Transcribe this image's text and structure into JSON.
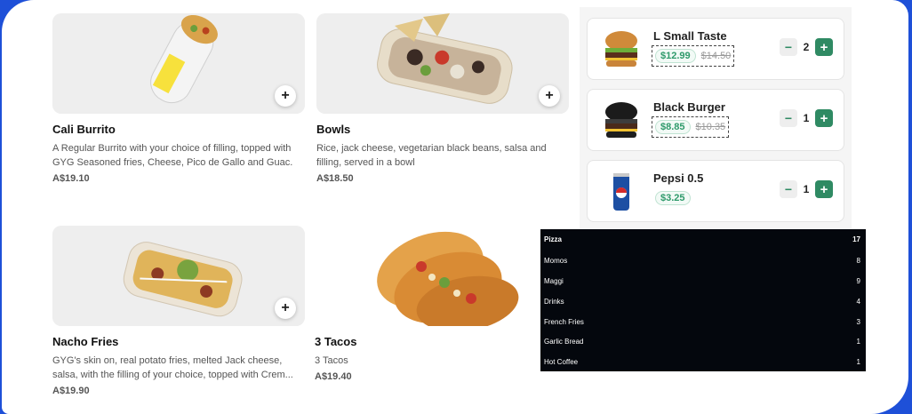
{
  "menu": {
    "items": [
      {
        "name": "Cali Burrito",
        "description": "A Regular Burrito with your choice of filling, topped with GYG Seasoned fries, Cheese, Pico de Gallo and Guac.",
        "price": "A$19.10",
        "add": "+"
      },
      {
        "name": "Bowls",
        "description": "Rice, jack cheese, vegetarian black beans, salsa and filling, served in a bowl",
        "price": "A$18.50",
        "add": "+"
      },
      {
        "name": "Nacho Fries",
        "description": "GYG's skin on, real potato fries, melted Jack cheese, salsa, with the filling of your choice, topped with Crem...",
        "price": "A$19.90",
        "add": "+"
      },
      {
        "name": "3 Tacos",
        "description": "3 Tacos",
        "price": "A$19.40"
      }
    ]
  },
  "cart": {
    "items": [
      {
        "name": "L Small Taste",
        "price": "$12.99",
        "old_price": "$14.50",
        "qty": "2",
        "minus": "−",
        "plus": "+"
      },
      {
        "name": "Black Burger",
        "price": "$8.85",
        "old_price": "$10.35",
        "qty": "1",
        "minus": "−",
        "plus": "+"
      },
      {
        "name": "Pepsi 0.5",
        "price": "$3.25",
        "qty": "1",
        "minus": "−",
        "plus": "+"
      }
    ]
  },
  "categories": [
    {
      "name": "Pizza",
      "count": "17"
    },
    {
      "name": "Momos",
      "count": "8"
    },
    {
      "name": "Maggi",
      "count": "9"
    },
    {
      "name": "Drinks",
      "count": "4"
    },
    {
      "name": "French Fries",
      "count": "3"
    },
    {
      "name": "Garlic Bread",
      "count": "1"
    },
    {
      "name": "Hot Coffee",
      "count": "1"
    }
  ],
  "colors": {
    "accent": "#2f8a63",
    "price_green": "#2f9a6b",
    "frame": "#1e50d8",
    "category_bg": "#04070d"
  },
  "icons": [
    "plus-icon",
    "minus-icon",
    "burrito-photo",
    "bowl-photo",
    "nacho-fries-photo",
    "tacos-photo",
    "burger-photo",
    "black-burger-photo",
    "pepsi-can-photo"
  ]
}
